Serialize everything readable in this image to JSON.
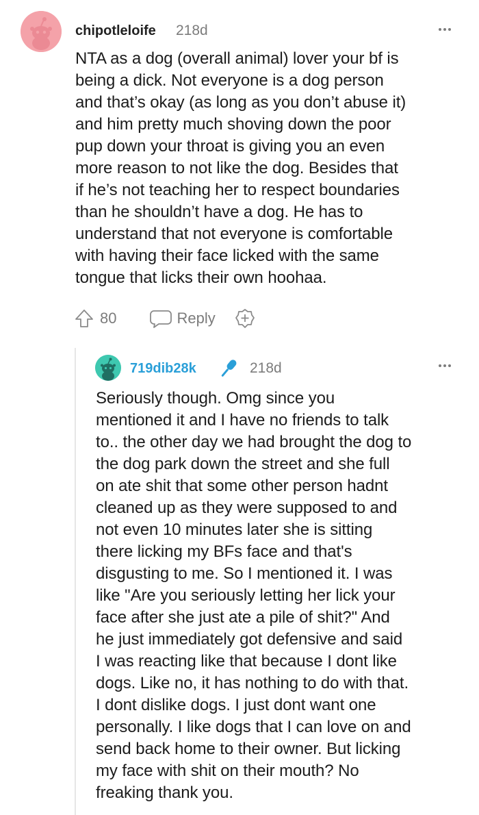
{
  "comments": [
    {
      "username": "chipotleloife",
      "timestamp": "218d",
      "avatar_color": "#f4a2a9",
      "body": "NTA as a dog (overall animal) lover your bf is\nbeing a dick. Not everyone is a dog person\nand that’s okay (as long as you don’t abuse it)\nand him pretty much shoving down the poor\npup down your throat is giving you an even\nmore reason to not like the dog. Besides that\nif he’s not teaching her to respect boundaries\nthan he shouldn’t have a dog. He has to\nunderstand that not everyone is comfortable\nwith having their face licked with the same\ntongue that licks their own hoohaa.",
      "votes": "80",
      "reply_label": "Reply"
    },
    {
      "username": "719dib28k",
      "timestamp": "218d",
      "avatar_color": "#3ec8b0",
      "username_color": "#2a9fd8",
      "body": "Seriously though. Omg since you\nmentioned it and I have no friends to talk\nto.. the other day we had brought the dog to\nthe dog park down the street and she full\non ate shit that some other person hadnt\ncleaned up as they were supposed to and\nnot even 10 minutes later she is sitting\nthere licking my BFs face and that's\ndisgusting to me. So I mentioned it. I was\nlike \"Are you seriously letting her lick your\nface after she just ate a pile of shit?\" And\nhe just immediately got defensive and said\nI was reacting like that because I dont like\ndogs. Like no, it has nothing to do with that.\nI dont dislike dogs. I just dont want one\npersonally. I like dogs that I can love on and\nsend back home to their owner. But licking\nmy face with shit on their mouth? No\nfreaking thank you."
    }
  ],
  "icons": {
    "upvote": "upvote-arrow-icon",
    "reply": "speech-bubble-icon",
    "award": "add-award-icon",
    "more": "more-options-icon",
    "mic": "microphone-icon"
  }
}
